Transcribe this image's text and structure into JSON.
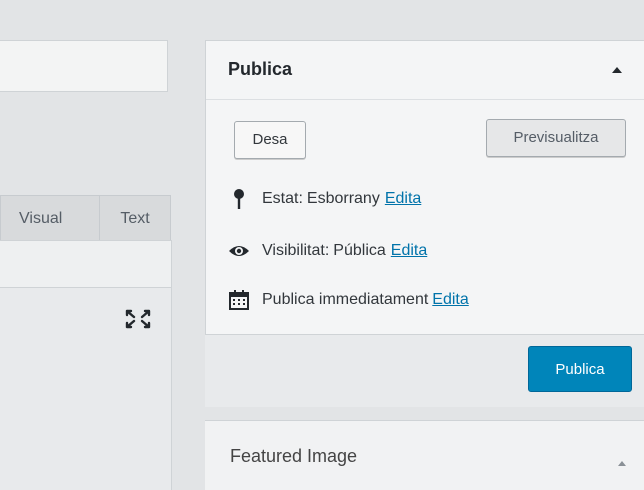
{
  "editor": {
    "tabs": [
      {
        "label": "Visual"
      },
      {
        "label": "Text"
      }
    ]
  },
  "publish": {
    "title": "Publica",
    "save_label": "Desa",
    "preview_label": "Previsualitza",
    "status": {
      "label": "Estat:",
      "value": "Esborrany",
      "edit": "Edita"
    },
    "visibility": {
      "label": "Visibilitat:",
      "value": "Pública",
      "edit": "Edita"
    },
    "schedule": {
      "label": "Publica immediatament",
      "edit": "Edita"
    },
    "publish_button": "Publica"
  },
  "featured_image": {
    "title": "Featured Image"
  },
  "icons": {
    "status": "pin-icon",
    "visibility": "eye-icon",
    "schedule": "calendar-icon",
    "fullscreen": "fullscreen-icon",
    "collapse": "triangle-up-icon"
  },
  "colors": {
    "primary": "#0085ba",
    "link": "#0073aa"
  }
}
